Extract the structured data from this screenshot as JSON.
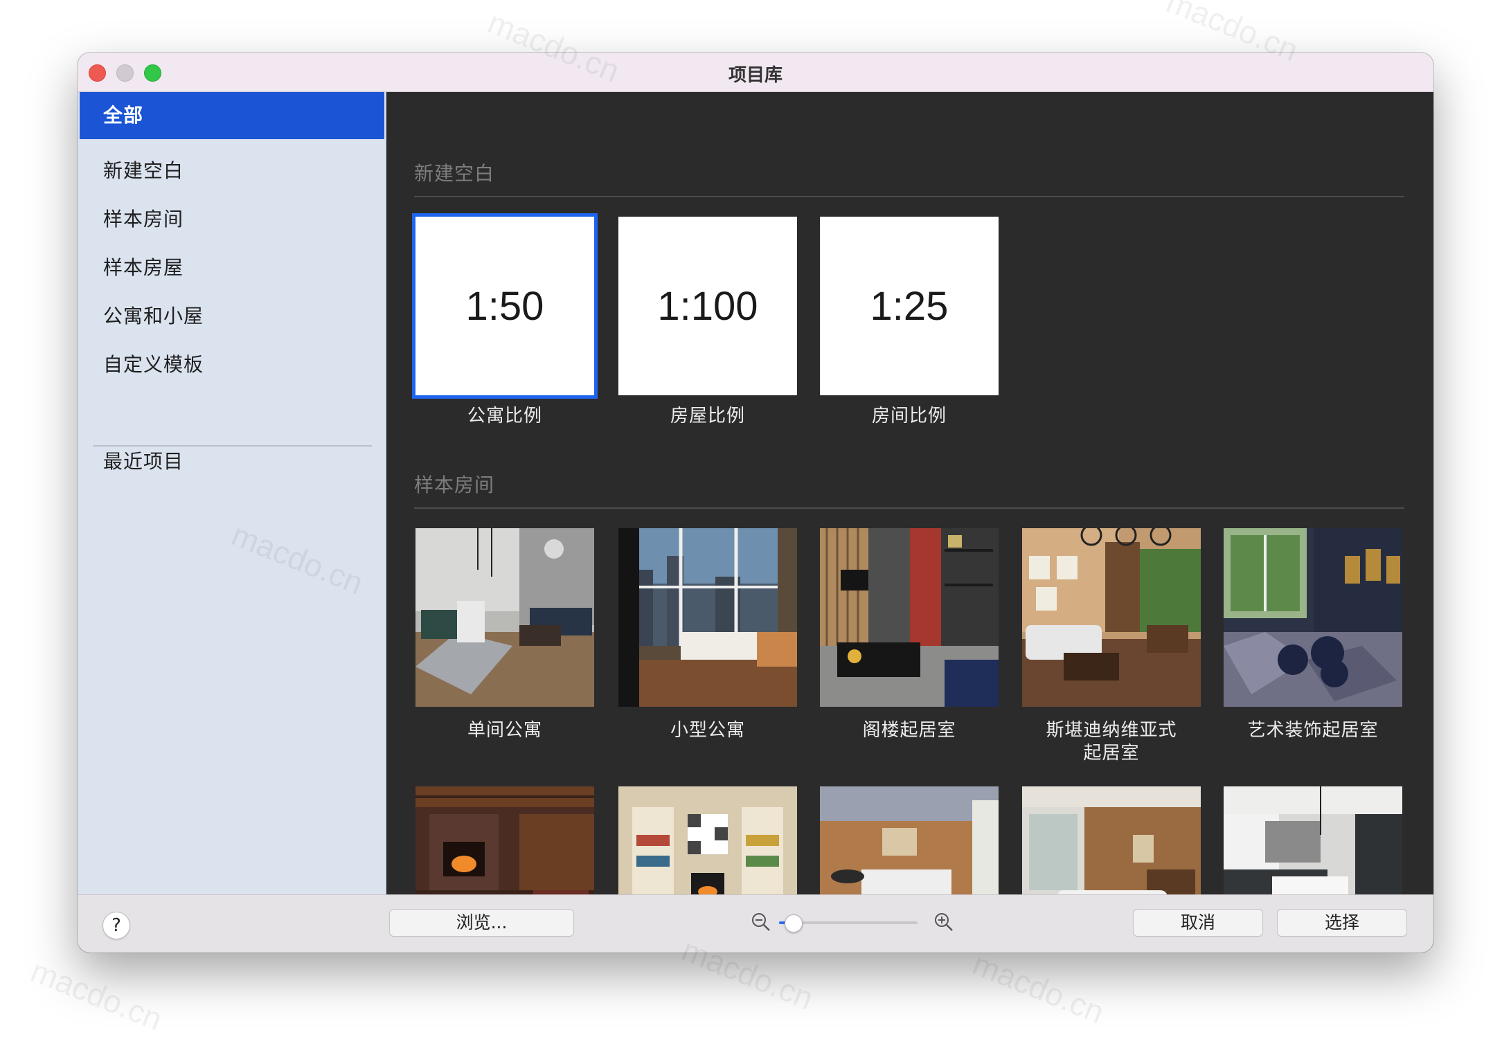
{
  "window": {
    "title": "项目库",
    "traffic_lights": [
      "close",
      "minimize",
      "zoom"
    ]
  },
  "sidebar": {
    "items": [
      {
        "label": "全部",
        "active": true
      },
      {
        "label": "新建空白",
        "active": false
      },
      {
        "label": "样本房间",
        "active": false
      },
      {
        "label": "样本房屋",
        "active": false
      },
      {
        "label": "公寓和小屋",
        "active": false
      },
      {
        "label": "自定义模板",
        "active": false
      }
    ],
    "recent_label": "最近项目"
  },
  "sections": {
    "blank": {
      "title": "新建空白",
      "tiles": [
        {
          "ratio": "1:50",
          "label": "公寓比例",
          "selected": true
        },
        {
          "ratio": "1:100",
          "label": "房屋比例",
          "selected": false
        },
        {
          "ratio": "1:25",
          "label": "房间比例",
          "selected": false
        }
      ]
    },
    "samples": {
      "title": "样本房间",
      "row1": [
        {
          "label": "单间公寓"
        },
        {
          "label": "小型公寓"
        },
        {
          "label": "阁楼起居室"
        },
        {
          "label": "斯堪迪纳维亚式起居室",
          "line1": "斯堪迪纳维亚式",
          "line2": "起居室"
        },
        {
          "label": "艺术装饰起居室"
        }
      ]
    }
  },
  "bottom_bar": {
    "help_label": "?",
    "browse_label": "浏览...",
    "cancel_label": "取消",
    "choose_label": "选择",
    "zoom_level": 0.1,
    "zoom_out_icon": "zoom-out-icon",
    "zoom_in_icon": "zoom-in-icon"
  },
  "colors": {
    "accent": "#1b55d6",
    "selection": "#1f64f0",
    "content_bg": "#2b2b2b",
    "sidebar_bg": "#dbe3ef"
  }
}
